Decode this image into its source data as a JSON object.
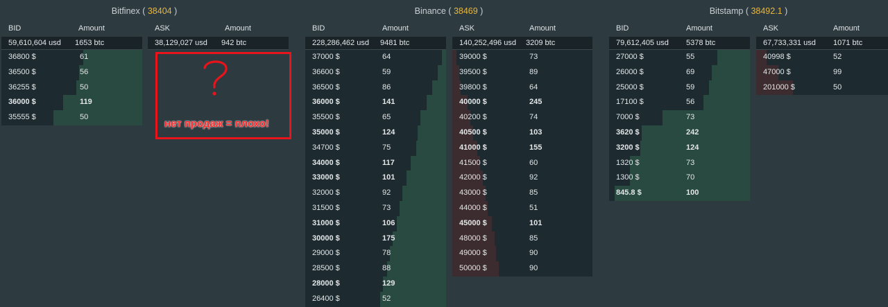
{
  "colors": {
    "background": "#2d3a40",
    "row": "#1d2a2f",
    "total_row": "#1a2428",
    "bid_bar": "#294a40",
    "ask_bar": "#3c2c2f",
    "price_accent": "#e8b63d",
    "annotation": "#e8141c"
  },
  "headers": {
    "bid": "BID",
    "ask": "ASK",
    "amount": "Amount"
  },
  "exchanges": [
    {
      "name": "Bitfinex",
      "price": "38404",
      "bid": {
        "total_usd": "59,610,604 usd",
        "total_btc": "1653 btc",
        "rows": [
          {
            "price": "36800 $",
            "amount": "61",
            "bold": false,
            "depth": 0.42
          },
          {
            "price": "36500 $",
            "amount": "56",
            "bold": false,
            "depth": 0.45
          },
          {
            "price": "36255 $",
            "amount": "50",
            "bold": false,
            "depth": 0.47
          },
          {
            "price": "36000 $",
            "amount": "119",
            "bold": true,
            "depth": 0.56
          },
          {
            "price": "35555 $",
            "amount": "50",
            "bold": false,
            "depth": 0.63
          }
        ]
      },
      "ask": {
        "total_usd": "38,129,027 usd",
        "total_btc": "942 btc",
        "rows": []
      }
    },
    {
      "name": "Binance",
      "price": "38469",
      "bid": {
        "total_usd": "228,286,462 usd",
        "total_btc": "9481 btc",
        "rows": [
          {
            "price": "37000 $",
            "amount": "64",
            "bold": false,
            "depth": 0.03
          },
          {
            "price": "36600 $",
            "amount": "59",
            "bold": false,
            "depth": 0.06
          },
          {
            "price": "36500 $",
            "amount": "86",
            "bold": false,
            "depth": 0.1
          },
          {
            "price": "36000 $",
            "amount": "141",
            "bold": true,
            "depth": 0.14
          },
          {
            "price": "35500 $",
            "amount": "65",
            "bold": false,
            "depth": 0.18
          },
          {
            "price": "35000 $",
            "amount": "124",
            "bold": true,
            "depth": 0.2
          },
          {
            "price": "34700 $",
            "amount": "75",
            "bold": false,
            "depth": 0.21
          },
          {
            "price": "34000 $",
            "amount": "117",
            "bold": true,
            "depth": 0.25
          },
          {
            "price": "33000 $",
            "amount": "101",
            "bold": true,
            "depth": 0.28
          },
          {
            "price": "32000 $",
            "amount": "92",
            "bold": false,
            "depth": 0.31
          },
          {
            "price": "31500 $",
            "amount": "73",
            "bold": false,
            "depth": 0.33
          },
          {
            "price": "31000 $",
            "amount": "106",
            "bold": true,
            "depth": 0.35
          },
          {
            "price": "30000 $",
            "amount": "175",
            "bold": true,
            "depth": 0.38
          },
          {
            "price": "29000 $",
            "amount": "78",
            "bold": false,
            "depth": 0.4
          },
          {
            "price": "28500 $",
            "amount": "88",
            "bold": false,
            "depth": 0.42
          },
          {
            "price": "28000 $",
            "amount": "129",
            "bold": true,
            "depth": 0.45
          },
          {
            "price": "26400 $",
            "amount": "52",
            "bold": false,
            "depth": 0.47
          }
        ]
      },
      "ask": {
        "total_usd": "140,252,496 usd",
        "total_btc": "3209 btc",
        "rows": [
          {
            "price": "39000 $",
            "amount": "73",
            "bold": false,
            "depth": 0.03
          },
          {
            "price": "39500 $",
            "amount": "89",
            "bold": false,
            "depth": 0.05
          },
          {
            "price": "39800 $",
            "amount": "64",
            "bold": false,
            "depth": 0.06
          },
          {
            "price": "40000 $",
            "amount": "245",
            "bold": true,
            "depth": 0.11
          },
          {
            "price": "40200 $",
            "amount": "74",
            "bold": false,
            "depth": 0.13
          },
          {
            "price": "40500 $",
            "amount": "103",
            "bold": true,
            "depth": 0.15
          },
          {
            "price": "41000 $",
            "amount": "155",
            "bold": true,
            "depth": 0.18
          },
          {
            "price": "41500 $",
            "amount": "60",
            "bold": false,
            "depth": 0.2
          },
          {
            "price": "42000 $",
            "amount": "92",
            "bold": false,
            "depth": 0.22
          },
          {
            "price": "43000 $",
            "amount": "85",
            "bold": false,
            "depth": 0.24
          },
          {
            "price": "44000 $",
            "amount": "51",
            "bold": false,
            "depth": 0.25
          },
          {
            "price": "45000 $",
            "amount": "101",
            "bold": true,
            "depth": 0.28
          },
          {
            "price": "48000 $",
            "amount": "85",
            "bold": false,
            "depth": 0.3
          },
          {
            "price": "49000 $",
            "amount": "90",
            "bold": false,
            "depth": 0.31
          },
          {
            "price": "50000 $",
            "amount": "90",
            "bold": false,
            "depth": 0.33
          }
        ]
      }
    },
    {
      "name": "Bitstamp",
      "price": "38492.1",
      "bid": {
        "total_usd": "79,612,405 usd",
        "total_btc": "5378 btc",
        "rows": [
          {
            "price": "27000 $",
            "amount": "55",
            "bold": false,
            "depth": 0.23
          },
          {
            "price": "26000 $",
            "amount": "69",
            "bold": false,
            "depth": 0.27
          },
          {
            "price": "25000 $",
            "amount": "59",
            "bold": false,
            "depth": 0.29
          },
          {
            "price": "17100 $",
            "amount": "56",
            "bold": false,
            "depth": 0.33
          },
          {
            "price": "7000 $",
            "amount": "73",
            "bold": false,
            "depth": 0.62
          },
          {
            "price": "3620 $",
            "amount": "242",
            "bold": true,
            "depth": 0.77
          },
          {
            "price": "3200 $",
            "amount": "124",
            "bold": true,
            "depth": 0.78
          },
          {
            "price": "1320 $",
            "amount": "73",
            "bold": false,
            "depth": 0.85
          },
          {
            "price": "1300 $",
            "amount": "70",
            "bold": false,
            "depth": 0.85
          },
          {
            "price": "845.8 $",
            "amount": "100",
            "bold": true,
            "depth": 0.96
          }
        ]
      },
      "ask": {
        "total_usd": "67,733,331 usd",
        "total_btc": "1071 btc",
        "rows": [
          {
            "price": "40998 $",
            "amount": "52",
            "bold": false,
            "depth": 0.08
          },
          {
            "price": "47000 $",
            "amount": "99",
            "bold": false,
            "depth": 0.17
          },
          {
            "price": "201000 $",
            "amount": "50",
            "bold": false,
            "depth": 0.28
          }
        ]
      }
    }
  ],
  "annotation": {
    "text": "нет продаж = плохо!",
    "icon": "question-mark"
  }
}
